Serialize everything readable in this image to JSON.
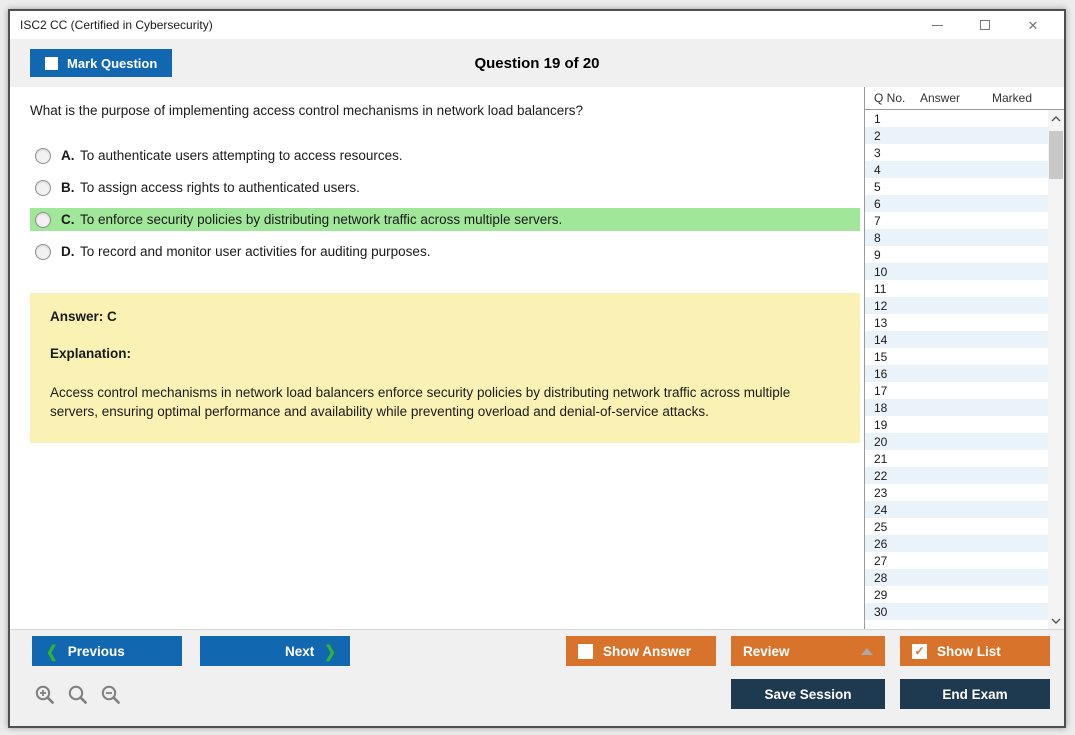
{
  "window": {
    "title": "ISC2 CC (Certified in Cybersecurity)",
    "close_glyph": "✕"
  },
  "header": {
    "mark_question_label": "Mark Question",
    "question_counter": "Question 19 of 20"
  },
  "question": {
    "text": "What is the purpose of implementing access control mechanisms in network load balancers?",
    "options": [
      {
        "letter": "A.",
        "text": "To authenticate users attempting to access resources.",
        "highlighted": false
      },
      {
        "letter": "B.",
        "text": "To assign access rights to authenticated users.",
        "highlighted": false
      },
      {
        "letter": "C.",
        "text": "To enforce security policies by distributing network traffic across multiple servers.",
        "highlighted": true
      },
      {
        "letter": "D.",
        "text": "To record and monitor user activities for auditing purposes.",
        "highlighted": false
      }
    ]
  },
  "answer_panel": {
    "answer_line": "Answer: C",
    "explanation_label": "Explanation:",
    "explanation_text": "Access control mechanisms in network load balancers enforce security policies by distributing network traffic across multiple servers, ensuring optimal performance and availability while preventing overload and denial-of-service attacks.",
    "background_color": "#faf2b4"
  },
  "sidebar": {
    "columns": [
      "Q No.",
      "Answer",
      "Marked"
    ],
    "rows": [
      {
        "q": "1",
        "answer": "",
        "marked": ""
      },
      {
        "q": "2",
        "answer": "",
        "marked": ""
      },
      {
        "q": "3",
        "answer": "",
        "marked": ""
      },
      {
        "q": "4",
        "answer": "",
        "marked": ""
      },
      {
        "q": "5",
        "answer": "",
        "marked": ""
      },
      {
        "q": "6",
        "answer": "",
        "marked": ""
      },
      {
        "q": "7",
        "answer": "",
        "marked": ""
      },
      {
        "q": "8",
        "answer": "",
        "marked": ""
      },
      {
        "q": "9",
        "answer": "",
        "marked": ""
      },
      {
        "q": "10",
        "answer": "",
        "marked": ""
      },
      {
        "q": "11",
        "answer": "",
        "marked": ""
      },
      {
        "q": "12",
        "answer": "",
        "marked": ""
      },
      {
        "q": "13",
        "answer": "",
        "marked": ""
      },
      {
        "q": "14",
        "answer": "",
        "marked": ""
      },
      {
        "q": "15",
        "answer": "",
        "marked": ""
      },
      {
        "q": "16",
        "answer": "",
        "marked": ""
      },
      {
        "q": "17",
        "answer": "",
        "marked": ""
      },
      {
        "q": "18",
        "answer": "",
        "marked": ""
      },
      {
        "q": "19",
        "answer": "",
        "marked": ""
      },
      {
        "q": "20",
        "answer": "",
        "marked": ""
      },
      {
        "q": "21",
        "answer": "",
        "marked": ""
      },
      {
        "q": "22",
        "answer": "",
        "marked": ""
      },
      {
        "q": "23",
        "answer": "",
        "marked": ""
      },
      {
        "q": "24",
        "answer": "",
        "marked": ""
      },
      {
        "q": "25",
        "answer": "",
        "marked": ""
      },
      {
        "q": "26",
        "answer": "",
        "marked": ""
      },
      {
        "q": "27",
        "answer": "",
        "marked": ""
      },
      {
        "q": "28",
        "answer": "",
        "marked": ""
      },
      {
        "q": "29",
        "answer": "",
        "marked": ""
      },
      {
        "q": "30",
        "answer": "",
        "marked": ""
      }
    ]
  },
  "footer": {
    "previous_label": "Previous",
    "next_label": "Next",
    "prev_chevron": "❮",
    "next_chevron": "❯",
    "show_answer_label": "Show Answer",
    "show_answer_checked": false,
    "review_label": "Review",
    "show_list_label": "Show List",
    "show_list_checked": true,
    "check_glyph": "✓",
    "save_session_label": "Save Session",
    "end_exam_label": "End Exam"
  },
  "colors": {
    "accent_blue": "#1267b1",
    "accent_orange": "#d8732b",
    "accent_navy": "#1e3a50",
    "highlight_green": "#a0e79a",
    "answer_yellow": "#faf2b4",
    "alt_row_blue": "#eaf2fa",
    "bar_gray": "#f0f0f0",
    "nav_chevron_green": "#2fb52f"
  }
}
